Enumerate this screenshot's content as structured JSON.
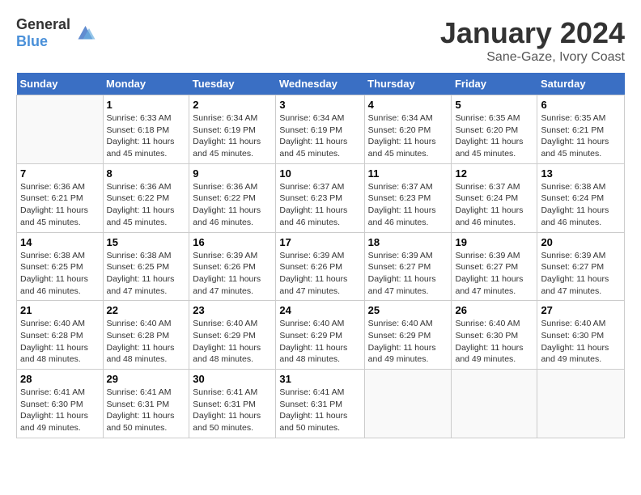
{
  "header": {
    "logo_general": "General",
    "logo_blue": "Blue",
    "month": "January 2024",
    "location": "Sane-Gaze, Ivory Coast"
  },
  "weekdays": [
    "Sunday",
    "Monday",
    "Tuesday",
    "Wednesday",
    "Thursday",
    "Friday",
    "Saturday"
  ],
  "weeks": [
    [
      {
        "day": "",
        "info": ""
      },
      {
        "day": "1",
        "info": "Sunrise: 6:33 AM\nSunset: 6:18 PM\nDaylight: 11 hours and 45 minutes."
      },
      {
        "day": "2",
        "info": "Sunrise: 6:34 AM\nSunset: 6:19 PM\nDaylight: 11 hours and 45 minutes."
      },
      {
        "day": "3",
        "info": "Sunrise: 6:34 AM\nSunset: 6:19 PM\nDaylight: 11 hours and 45 minutes."
      },
      {
        "day": "4",
        "info": "Sunrise: 6:34 AM\nSunset: 6:20 PM\nDaylight: 11 hours and 45 minutes."
      },
      {
        "day": "5",
        "info": "Sunrise: 6:35 AM\nSunset: 6:20 PM\nDaylight: 11 hours and 45 minutes."
      },
      {
        "day": "6",
        "info": "Sunrise: 6:35 AM\nSunset: 6:21 PM\nDaylight: 11 hours and 45 minutes."
      }
    ],
    [
      {
        "day": "7",
        "info": "Sunrise: 6:36 AM\nSunset: 6:21 PM\nDaylight: 11 hours and 45 minutes."
      },
      {
        "day": "8",
        "info": "Sunrise: 6:36 AM\nSunset: 6:22 PM\nDaylight: 11 hours and 45 minutes."
      },
      {
        "day": "9",
        "info": "Sunrise: 6:36 AM\nSunset: 6:22 PM\nDaylight: 11 hours and 46 minutes."
      },
      {
        "day": "10",
        "info": "Sunrise: 6:37 AM\nSunset: 6:23 PM\nDaylight: 11 hours and 46 minutes."
      },
      {
        "day": "11",
        "info": "Sunrise: 6:37 AM\nSunset: 6:23 PM\nDaylight: 11 hours and 46 minutes."
      },
      {
        "day": "12",
        "info": "Sunrise: 6:37 AM\nSunset: 6:24 PM\nDaylight: 11 hours and 46 minutes."
      },
      {
        "day": "13",
        "info": "Sunrise: 6:38 AM\nSunset: 6:24 PM\nDaylight: 11 hours and 46 minutes."
      }
    ],
    [
      {
        "day": "14",
        "info": "Sunrise: 6:38 AM\nSunset: 6:25 PM\nDaylight: 11 hours and 46 minutes."
      },
      {
        "day": "15",
        "info": "Sunrise: 6:38 AM\nSunset: 6:25 PM\nDaylight: 11 hours and 47 minutes."
      },
      {
        "day": "16",
        "info": "Sunrise: 6:39 AM\nSunset: 6:26 PM\nDaylight: 11 hours and 47 minutes."
      },
      {
        "day": "17",
        "info": "Sunrise: 6:39 AM\nSunset: 6:26 PM\nDaylight: 11 hours and 47 minutes."
      },
      {
        "day": "18",
        "info": "Sunrise: 6:39 AM\nSunset: 6:27 PM\nDaylight: 11 hours and 47 minutes."
      },
      {
        "day": "19",
        "info": "Sunrise: 6:39 AM\nSunset: 6:27 PM\nDaylight: 11 hours and 47 minutes."
      },
      {
        "day": "20",
        "info": "Sunrise: 6:39 AM\nSunset: 6:27 PM\nDaylight: 11 hours and 47 minutes."
      }
    ],
    [
      {
        "day": "21",
        "info": "Sunrise: 6:40 AM\nSunset: 6:28 PM\nDaylight: 11 hours and 48 minutes."
      },
      {
        "day": "22",
        "info": "Sunrise: 6:40 AM\nSunset: 6:28 PM\nDaylight: 11 hours and 48 minutes."
      },
      {
        "day": "23",
        "info": "Sunrise: 6:40 AM\nSunset: 6:29 PM\nDaylight: 11 hours and 48 minutes."
      },
      {
        "day": "24",
        "info": "Sunrise: 6:40 AM\nSunset: 6:29 PM\nDaylight: 11 hours and 48 minutes."
      },
      {
        "day": "25",
        "info": "Sunrise: 6:40 AM\nSunset: 6:29 PM\nDaylight: 11 hours and 49 minutes."
      },
      {
        "day": "26",
        "info": "Sunrise: 6:40 AM\nSunset: 6:30 PM\nDaylight: 11 hours and 49 minutes."
      },
      {
        "day": "27",
        "info": "Sunrise: 6:40 AM\nSunset: 6:30 PM\nDaylight: 11 hours and 49 minutes."
      }
    ],
    [
      {
        "day": "28",
        "info": "Sunrise: 6:41 AM\nSunset: 6:30 PM\nDaylight: 11 hours and 49 minutes."
      },
      {
        "day": "29",
        "info": "Sunrise: 6:41 AM\nSunset: 6:31 PM\nDaylight: 11 hours and 50 minutes."
      },
      {
        "day": "30",
        "info": "Sunrise: 6:41 AM\nSunset: 6:31 PM\nDaylight: 11 hours and 50 minutes."
      },
      {
        "day": "31",
        "info": "Sunrise: 6:41 AM\nSunset: 6:31 PM\nDaylight: 11 hours and 50 minutes."
      },
      {
        "day": "",
        "info": ""
      },
      {
        "day": "",
        "info": ""
      },
      {
        "day": "",
        "info": ""
      }
    ]
  ]
}
